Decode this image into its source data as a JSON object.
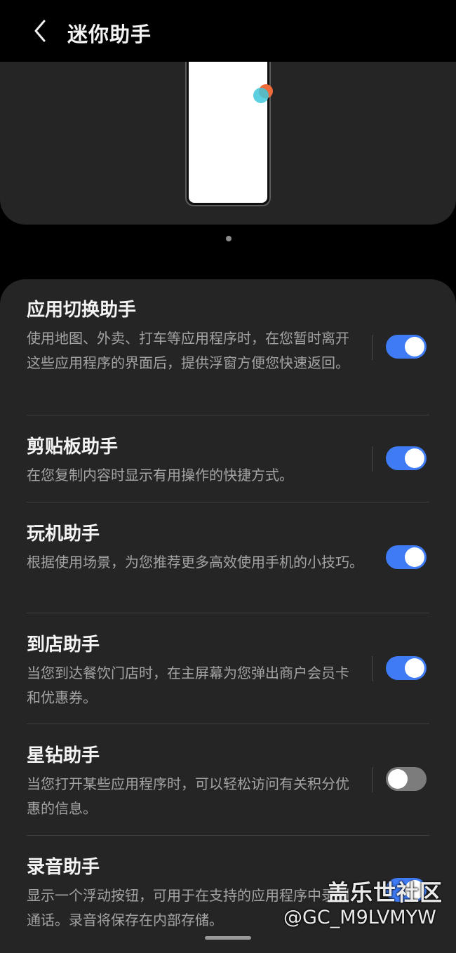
{
  "header": {
    "title": "迷你助手"
  },
  "watermark": {
    "brand": "盖乐世社区",
    "user": "@GC_M9LVMYW"
  },
  "settings": [
    {
      "title": "应用切换助手",
      "description": "使用地图、外卖、打车等应用程序时，在您暂时离开这些应用程序的界面后，提供浮窗方便您快速返回。",
      "enabled": true
    },
    {
      "title": "剪贴板助手",
      "description": "在您复制内容时显示有用操作的快捷方式。",
      "enabled": true
    },
    {
      "title": "玩机助手",
      "description": "根据使用场景，为您推荐更多高效使用手机的小技巧。",
      "enabled": true
    },
    {
      "title": "到店助手",
      "description": "当您到达餐饮门店时，在主屏幕为您弹出商户会员卡和优惠券。",
      "enabled": true
    },
    {
      "title": "星钻助手",
      "description": "当您打开某些应用程序时，可以轻松访问有关积分优惠的信息。",
      "enabled": false
    },
    {
      "title": "录音助手",
      "description": "显示一个浮动按钮，可用于在支持的应用程序中录制通话。录音将保存在内部存储。",
      "enabled": true
    }
  ],
  "colors": {
    "toggle_on": "#3e7bf5",
    "toggle_off": "#7c7c7c",
    "card_bg": "#252525"
  }
}
